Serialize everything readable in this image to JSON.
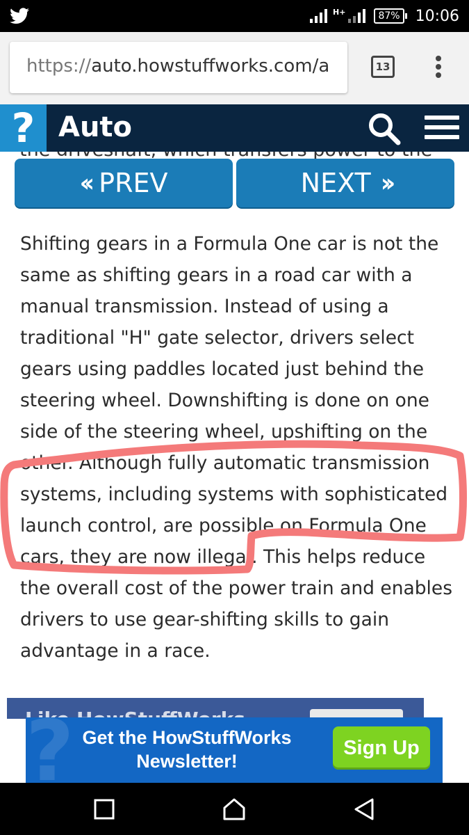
{
  "status_bar": {
    "notification_icon": "twitter-bird-icon",
    "network_type": "H+",
    "battery": "87%",
    "time": "10:06"
  },
  "browser": {
    "url_scheme": "https://",
    "url_host": "auto.howstuffworks.com/a",
    "tab_count": "13",
    "menu_icon": "overflow-menu-icon"
  },
  "site_header": {
    "logo_text": "?",
    "section_title": "Auto",
    "search_icon": "search-icon",
    "menu_icon": "hamburger-menu-icon",
    "peek_text": "the driveshaft, which transfers power to the"
  },
  "pager": {
    "prev_label": "PREV",
    "next_label": "NEXT"
  },
  "article": {
    "lines": [
      "Shifting gears in a Formula One car is not the",
      "same as shifting gears in a road car with a",
      "manual transmission. Instead of using a",
      "traditional \"H\" gate selector, drivers select",
      "gears using paddles located just behind the",
      "steering wheel. Downshifting is done on one",
      "side of the steering wheel, upshifting on the",
      "other. Although fully automatic transmission",
      "systems, including systems with sophisticated",
      "launch control, are possible on Formula One",
      "cars, they are now illegal. This helps reduce",
      "the overall cost of the power train and enables",
      "drivers to use gear-shifting skills to gain",
      "advantage in a race."
    ]
  },
  "annotation": {
    "color": "#f47a7a"
  },
  "ad": {
    "behind_text": "Like HowStuffWorks",
    "newsletter_line1": "Get the HowStuffWorks",
    "newsletter_line2": "Newsletter!",
    "signup_label": "Sign Up"
  },
  "android_nav": {
    "recents_icon": "square-recents-icon",
    "home_icon": "home-icon",
    "back_icon": "back-triangle-icon"
  }
}
